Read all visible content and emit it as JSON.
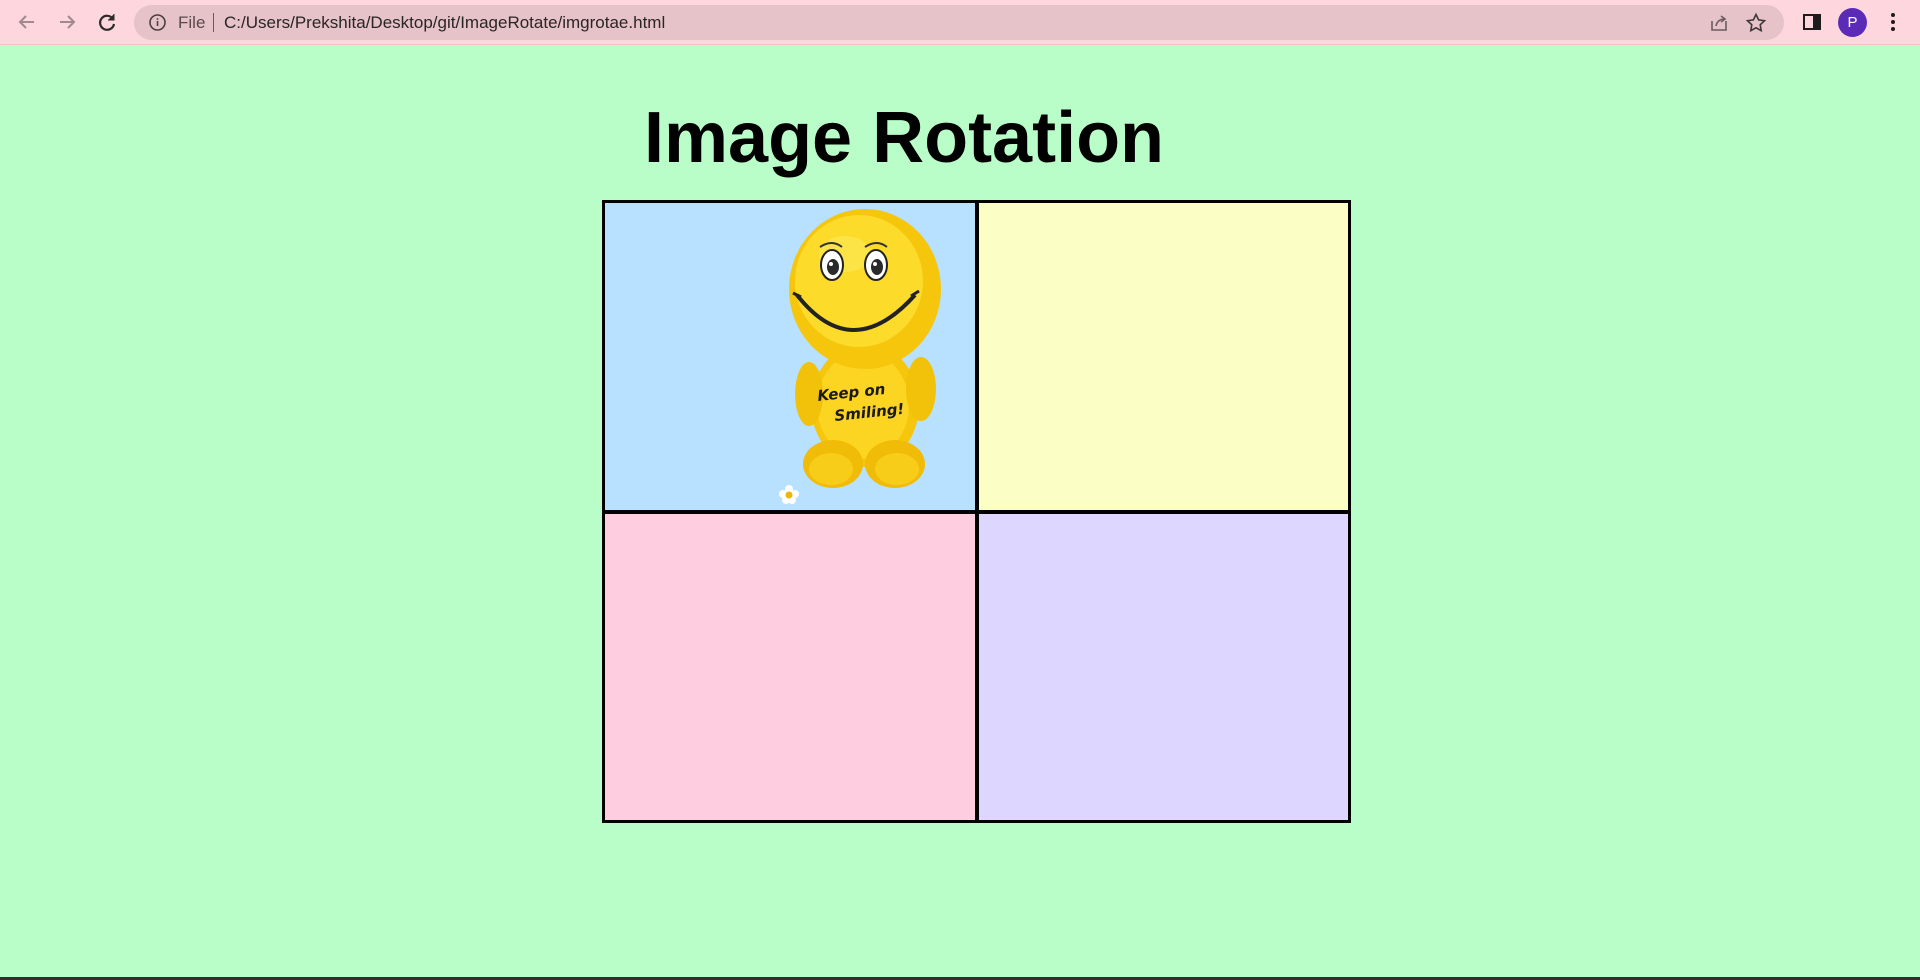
{
  "browser": {
    "scheme_label": "File",
    "url": "C:/Users/Prekshita/Desktop/git/ImageRotate/imgrotae.html",
    "profile_initial": "P",
    "icons": [
      "back-arrow-icon",
      "forward-arrow-icon",
      "reload-icon",
      "info-icon",
      "share-icon",
      "star-icon",
      "side-panel-icon",
      "kebab-menu-icon"
    ]
  },
  "page": {
    "title": "Image Rotation",
    "background": "#b9fec8",
    "cells": [
      {
        "color": "#b8e0ff",
        "has_image": true
      },
      {
        "color": "#fbffc6",
        "has_image": false
      },
      {
        "color": "#ffcde0",
        "has_image": false
      },
      {
        "color": "#ddd6ff",
        "has_image": false
      }
    ],
    "image": {
      "subject": "smiley-plush-toy",
      "text": "Keep on Smiling!"
    }
  }
}
